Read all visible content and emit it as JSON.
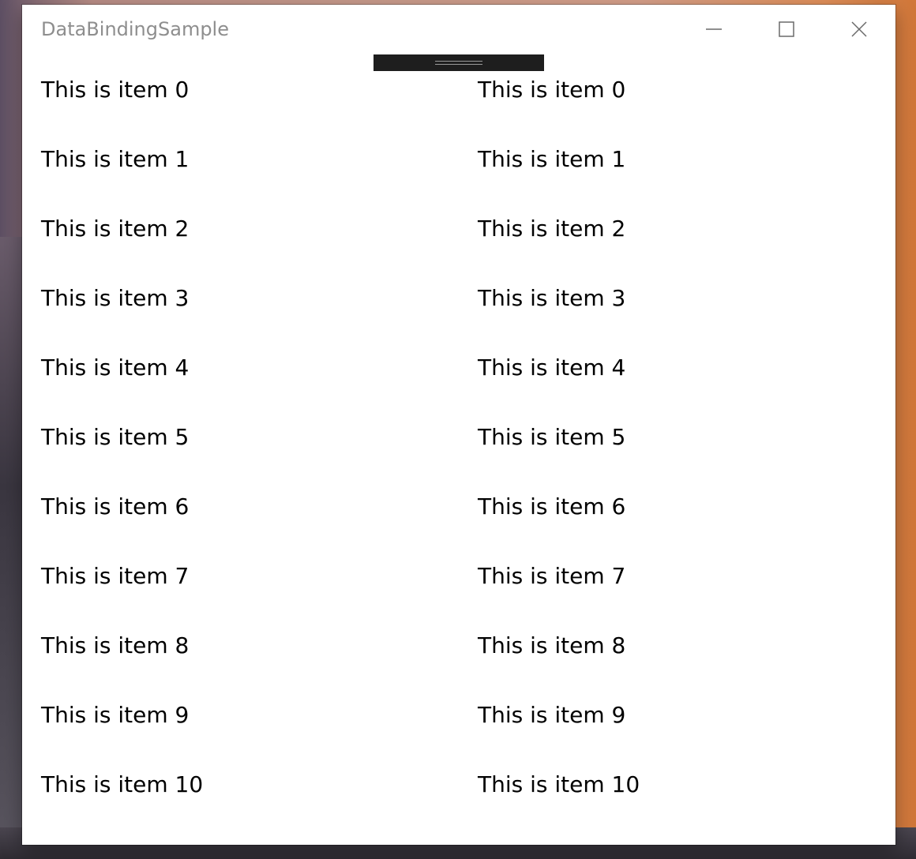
{
  "window": {
    "title": "DataBindingSample"
  },
  "caption_buttons": {
    "minimize_icon": "minimize-icon",
    "maximize_icon": "maximize-icon",
    "close_icon": "close-icon"
  },
  "lists": {
    "left": [
      "This is item 0",
      "This is item 1",
      "This is item 2",
      "This is item 3",
      "This is item 4",
      "This is item 5",
      "This is item 6",
      "This is item 7",
      "This is item 8",
      "This is item 9",
      "This is item 10"
    ],
    "right": [
      "This is item 0",
      "This is item 1",
      "This is item 2",
      "This is item 3",
      "This is item 4",
      "This is item 5",
      "This is item 6",
      "This is item 7",
      "This is item 8",
      "This is item 9",
      "This is item 10"
    ]
  },
  "colors": {
    "window_background": "#ffffff",
    "title_text": "#8e8e8e",
    "item_text": "#000000",
    "drag_handle": "#1e1e1e"
  }
}
